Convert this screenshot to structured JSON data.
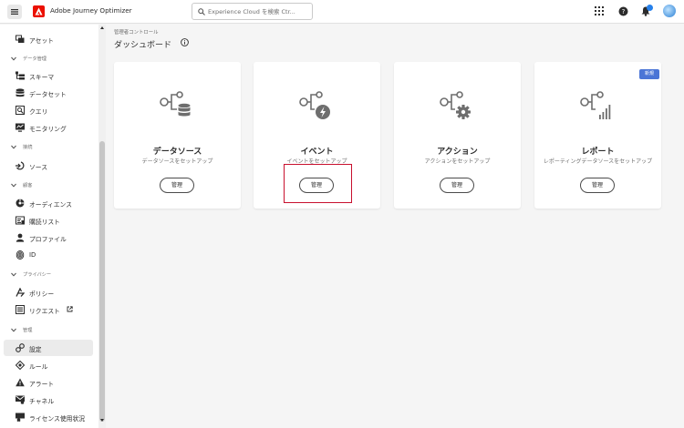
{
  "topbar": {
    "app_title": "Adobe Journey Optimizer",
    "search_placeholder": "Experience Cloud を検索 Ctr...",
    "icons": [
      "menu-icon",
      "adobe-logo",
      "search-icon",
      "apps-grid-icon",
      "help-icon",
      "bell-icon",
      "avatar"
    ]
  },
  "sidebar": {
    "items": [
      {
        "label": "アセット",
        "icon": "assets-icon"
      },
      {
        "section": "データ管理"
      },
      {
        "label": "スキーマ",
        "icon": "schema-icon"
      },
      {
        "label": "データセット",
        "icon": "dataset-icon"
      },
      {
        "label": "クエリ",
        "icon": "query-icon"
      },
      {
        "label": "モニタリング",
        "icon": "monitoring-icon"
      },
      {
        "section": "接続"
      },
      {
        "label": "ソース",
        "icon": "sources-icon"
      },
      {
        "section": "顧客"
      },
      {
        "label": "オーディエンス",
        "icon": "audience-icon"
      },
      {
        "label": "購読リスト",
        "icon": "subscription-list-icon"
      },
      {
        "label": "プロファイル",
        "icon": "profile-icon"
      },
      {
        "label": "ID",
        "icon": "identity-icon"
      },
      {
        "section": "プライバシー"
      },
      {
        "label": "ポリシー",
        "icon": "policy-icon"
      },
      {
        "label": "リクエスト",
        "icon": "request-icon"
      },
      {
        "section": "管理"
      },
      {
        "label": "設定",
        "icon": "settings-icon",
        "active": true
      },
      {
        "label": "ルール",
        "icon": "rules-icon"
      },
      {
        "label": "アラート",
        "icon": "alert-icon"
      },
      {
        "label": "チャネル",
        "icon": "channel-icon"
      },
      {
        "label": "ライセンス使用状況",
        "icon": "license-icon"
      }
    ]
  },
  "main": {
    "breadcrumb": "管理者コントロール",
    "title": "ダッシュボード",
    "cards": [
      {
        "title": "データソース",
        "subtitle": "データソースをセットアップ",
        "button": "管理",
        "icon": "data-source-icon"
      },
      {
        "title": "イベント",
        "subtitle": "イベントをセットアップ",
        "button": "管理",
        "icon": "event-icon"
      },
      {
        "title": "アクション",
        "subtitle": "アクションをセットアップ",
        "button": "管理",
        "icon": "action-icon"
      },
      {
        "title": "レポート",
        "subtitle": "レポーティングデータソースをセットアップ",
        "button": "管理",
        "icon": "report-icon",
        "badge": "新規"
      }
    ]
  },
  "colors": {
    "brand": "#eb1000",
    "accent": "#2680eb",
    "badge": "#4b75d6",
    "highlight": "#c8102e"
  }
}
